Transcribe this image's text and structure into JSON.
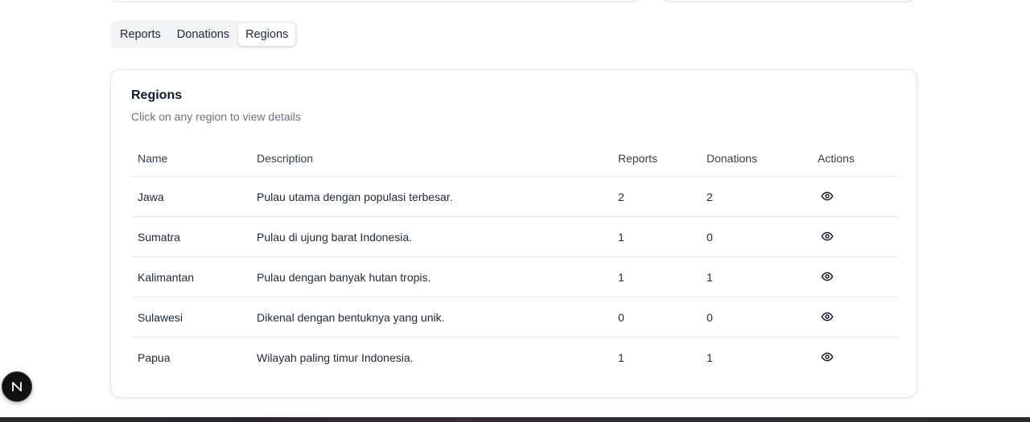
{
  "tabs": [
    {
      "label": "Reports",
      "active": false
    },
    {
      "label": "Donations",
      "active": false
    },
    {
      "label": "Regions",
      "active": true
    }
  ],
  "card": {
    "title": "Regions",
    "subtitle": "Click on any region to view details"
  },
  "table": {
    "headers": [
      "Name",
      "Description",
      "Reports",
      "Donations",
      "Actions"
    ],
    "rows": [
      {
        "name": "Jawa",
        "description": "Pulau utama dengan populasi terbesar.",
        "reports": "2",
        "donations": "2",
        "action_icon": "eye-icon"
      },
      {
        "name": "Sumatra",
        "description": "Pulau di ujung barat Indonesia.",
        "reports": "1",
        "donations": "0",
        "action_icon": "eye-icon"
      },
      {
        "name": "Kalimantan",
        "description": "Pulau dengan banyak hutan tropis.",
        "reports": "1",
        "donations": "1",
        "action_icon": "eye-icon"
      },
      {
        "name": "Sulawesi",
        "description": "Dikenal dengan bentuknya yang unik.",
        "reports": "0",
        "donations": "0",
        "action_icon": "eye-icon"
      },
      {
        "name": "Papua",
        "description": "Wilayah paling timur Indonesia.",
        "reports": "1",
        "donations": "1",
        "action_icon": "eye-icon"
      }
    ]
  },
  "badge": {
    "letter": "N"
  },
  "colors": {
    "text": "#111827",
    "muted": "#6b7280",
    "border": "#e5e7eb",
    "tab_bg": "#f3f4f6",
    "badge_bg": "#111111"
  }
}
